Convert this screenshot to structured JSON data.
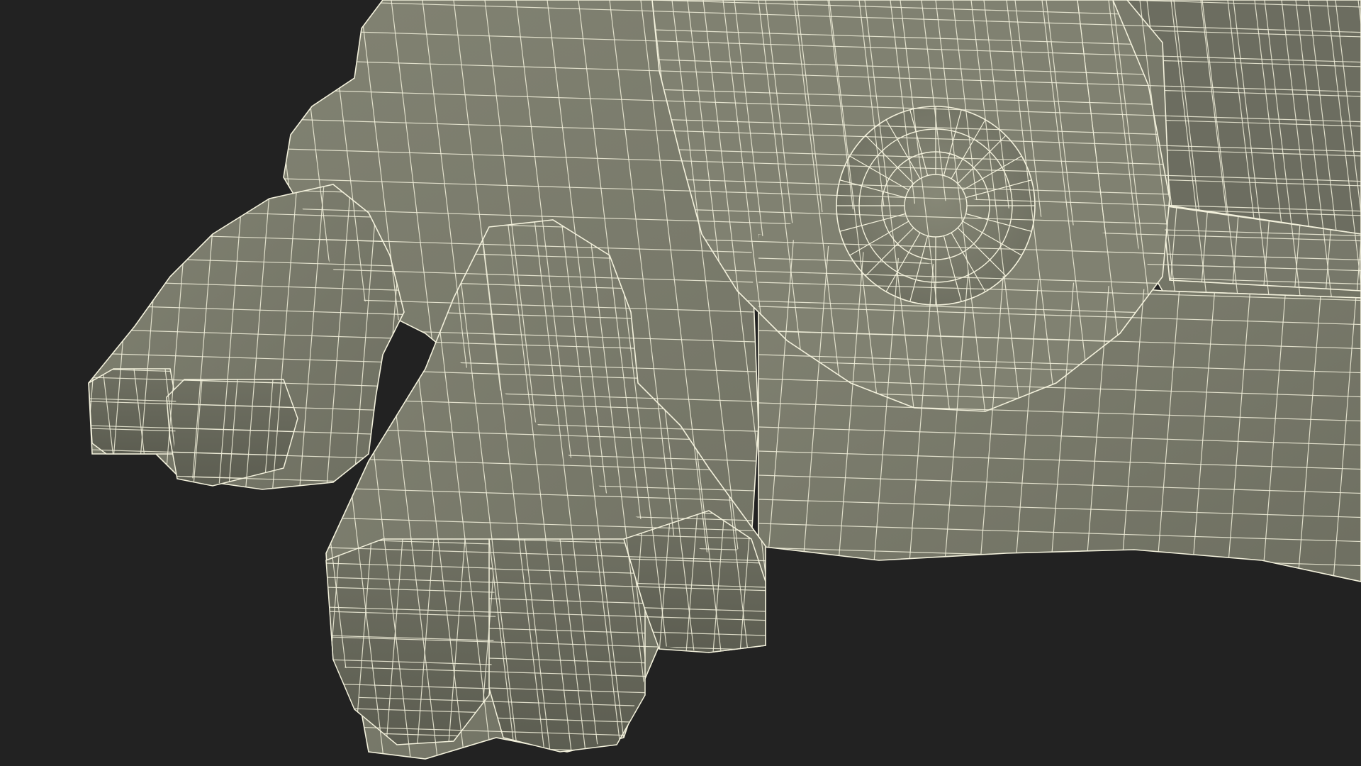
{
  "scene": {
    "subject": "wireframe-3d-model",
    "background_color": "#222222",
    "surface_color": "#7a7b6b",
    "shadow_color": "#5f6053",
    "highlight_color": "#8a8b7a",
    "wire_color": "#f3f1dc"
  }
}
